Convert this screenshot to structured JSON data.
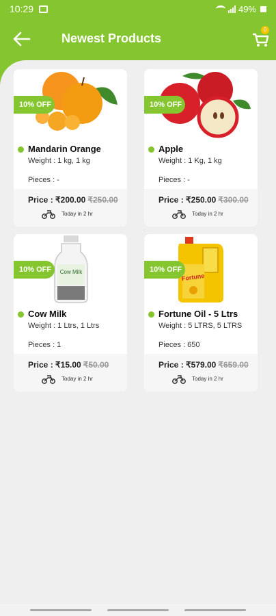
{
  "status_bar": {
    "time": "10:29",
    "battery": "49%"
  },
  "header": {
    "title": "Newest Products",
    "cart_count": "0"
  },
  "products": [
    {
      "name": "Mandarin Orange",
      "discount": "10% OFF",
      "weight": "Weight : 1 kg, 1 kg",
      "pieces": "Pieces : -",
      "price": "Price : ₹200.00",
      "old_price": "₹250.00",
      "delivery": "Today in 2 hr"
    },
    {
      "name": "Apple",
      "discount": "10% OFF",
      "weight": "Weight : 1 Kg, 1 kg",
      "pieces": "Pieces : -",
      "price": "Price : ₹250.00",
      "old_price": "₹300.00",
      "delivery": "Today in 2 hr"
    },
    {
      "name": "Cow Milk",
      "discount": "10% OFF",
      "weight": "Weight : 1 Ltrs, 1 Ltrs",
      "pieces": "Pieces : 1",
      "price": "Price : ₹15.00",
      "old_price": "₹50.00",
      "delivery": "Today in 2 hr"
    },
    {
      "name": "Fortune Oil - 5 Ltrs",
      "discount": "10% OFF",
      "weight": "Weight : 5 LTRS, 5 LTRS",
      "pieces": "Pieces : 650",
      "price": "Price : ₹579.00",
      "old_price": "₹659.00",
      "delivery": "Today in 2 hr"
    }
  ],
  "product_image_text": {
    "milk_label": "Cow Milk",
    "oil_brand": "Fortune"
  },
  "colors": {
    "accent": "#85c630",
    "badge": "#f5c400"
  }
}
